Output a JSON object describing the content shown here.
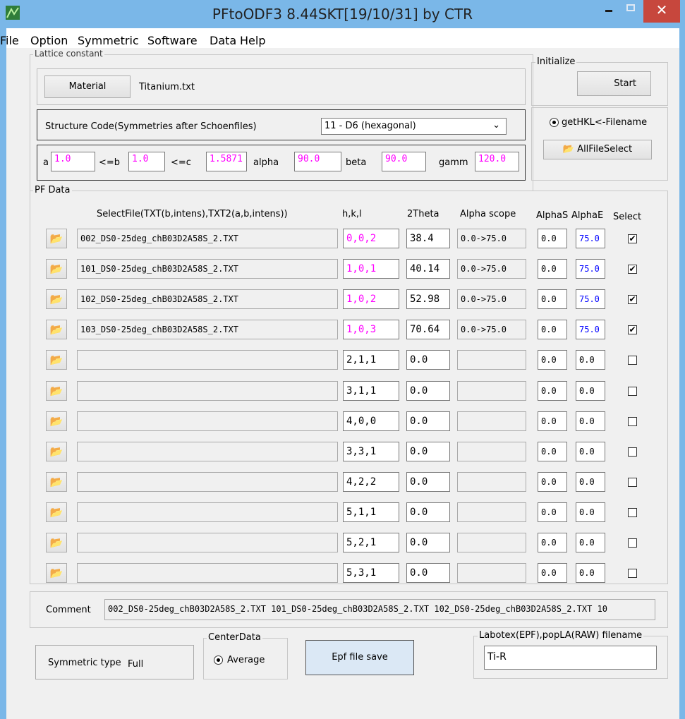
{
  "window": {
    "title": "PFtoODF3 8.44SKT[19/10/31] by CTR"
  },
  "menu": [
    "File",
    "Option",
    "Symmetric",
    "Software",
    "Data",
    "Help"
  ],
  "lattice": {
    "legend": "Lattice constant",
    "material_button": "Material",
    "material_file": "Titanium.txt",
    "structure_label": "Structure Code(Symmetries after Schoenfiles)",
    "structure_value": "11 - D6 (hexagonal)",
    "a_label": "a",
    "a_value": "1.0",
    "b_label": "<=b",
    "b_value": "1.0",
    "c_label": "<=c",
    "c_value": "1.5871",
    "alpha_label": "alpha",
    "alpha_value": "90.0",
    "beta_label": "beta",
    "beta_value": "90.0",
    "gamm_label": "gamm",
    "gamm_value": "120.0"
  },
  "initialize": {
    "legend": "Initialize",
    "start_button": "Start",
    "radio_label": "getHKL<-Filename",
    "allfile_button": "AllFileSelect"
  },
  "pfdata": {
    "legend": "PF Data",
    "headers": {
      "file": "SelectFile(TXT(b,intens),TXT2(a,b,intens))",
      "hkl": "h,k,l",
      "theta": "2Theta",
      "alpha": "Alpha scope",
      "alphas": "AlphaS",
      "alphae": "AlphaE",
      "select": "Select"
    },
    "rows": [
      {
        "file": "002_DS0-25deg_chB03D2A58S_2.TXT",
        "hkl": "0,0,2",
        "theta": "38.4",
        "scope": "0.0->75.0",
        "alphas": "0.0",
        "alphae": "75.0",
        "checked": true,
        "active": true
      },
      {
        "file": "101_DS0-25deg_chB03D2A58S_2.TXT",
        "hkl": "1,0,1",
        "theta": "40.14",
        "scope": "0.0->75.0",
        "alphas": "0.0",
        "alphae": "75.0",
        "checked": true,
        "active": true
      },
      {
        "file": "102_DS0-25deg_chB03D2A58S_2.TXT",
        "hkl": "1,0,2",
        "theta": "52.98",
        "scope": "0.0->75.0",
        "alphas": "0.0",
        "alphae": "75.0",
        "checked": true,
        "active": true
      },
      {
        "file": "103_DS0-25deg_chB03D2A58S_2.TXT",
        "hkl": "1,0,3",
        "theta": "70.64",
        "scope": "0.0->75.0",
        "alphas": "0.0",
        "alphae": "75.0",
        "checked": true,
        "active": true
      },
      {
        "file": "",
        "hkl": "2,1,1",
        "theta": "0.0",
        "scope": "",
        "alphas": "0.0",
        "alphae": "0.0",
        "checked": false,
        "active": false
      },
      {
        "file": "",
        "hkl": "3,1,1",
        "theta": "0.0",
        "scope": "",
        "alphas": "0.0",
        "alphae": "0.0",
        "checked": false,
        "active": false
      },
      {
        "file": "",
        "hkl": "4,0,0",
        "theta": "0.0",
        "scope": "",
        "alphas": "0.0",
        "alphae": "0.0",
        "checked": false,
        "active": false
      },
      {
        "file": "",
        "hkl": "3,3,1",
        "theta": "0.0",
        "scope": "",
        "alphas": "0.0",
        "alphae": "0.0",
        "checked": false,
        "active": false
      },
      {
        "file": "",
        "hkl": "4,2,2",
        "theta": "0.0",
        "scope": "",
        "alphas": "0.0",
        "alphae": "0.0",
        "checked": false,
        "active": false
      },
      {
        "file": "",
        "hkl": "5,1,1",
        "theta": "0.0",
        "scope": "",
        "alphas": "0.0",
        "alphae": "0.0",
        "checked": false,
        "active": false
      },
      {
        "file": "",
        "hkl": "5,2,1",
        "theta": "0.0",
        "scope": "",
        "alphas": "0.0",
        "alphae": "0.0",
        "checked": false,
        "active": false
      },
      {
        "file": "",
        "hkl": "5,3,1",
        "theta": "0.0",
        "scope": "",
        "alphas": "0.0",
        "alphae": "0.0",
        "checked": false,
        "active": false
      }
    ]
  },
  "comment": {
    "label": "Comment",
    "value": "002_DS0-25deg_chB03D2A58S_2.TXT 101_DS0-25deg_chB03D2A58S_2.TXT 102_DS0-25deg_chB03D2A58S_2.TXT 10"
  },
  "bottom": {
    "symmetric_label": "Symmetric type",
    "symmetric_value": "Full",
    "center_legend": "CenterData",
    "center_radio": "Average",
    "save_button": "Epf file save",
    "labotex_legend": "Labotex(EPF),popLA(RAW) filename",
    "labotex_value": "Ti-R"
  }
}
